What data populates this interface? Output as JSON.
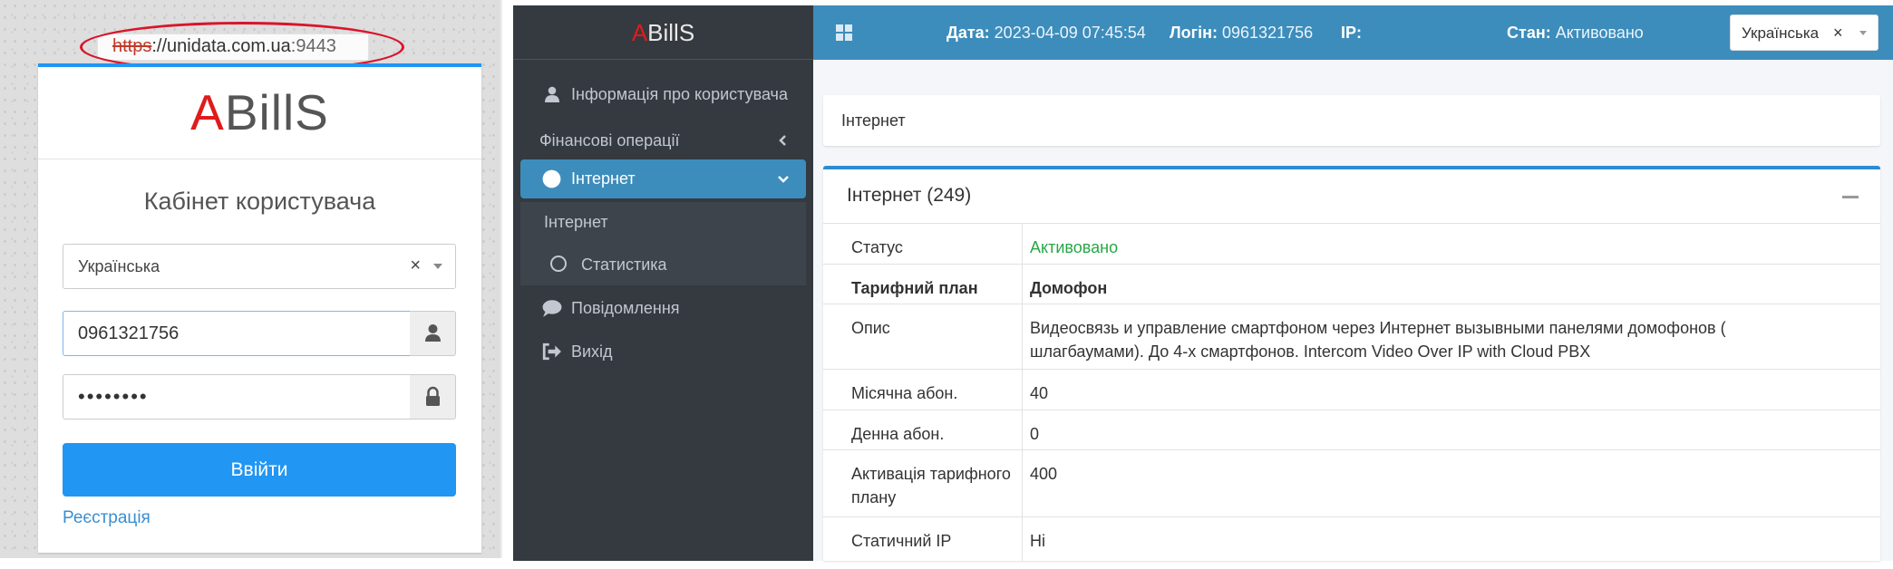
{
  "login": {
    "url_protocol": "https",
    "url_rest": "://unidata.com.ua",
    "url_port": ":9443",
    "logo_a": "A",
    "logo_rest": "BillS",
    "title": "Кабінет користувача",
    "language": "Українська",
    "clear_symbol": "×",
    "phone_value": "0961321756",
    "password_value": "••••••••",
    "login_button": "Ввійти",
    "register_link": "Реєстрація"
  },
  "sidebar": {
    "logo_a": "A",
    "logo_rest": "BillS",
    "items": [
      {
        "label": "Інформація про користувача",
        "icon": "user-icon"
      },
      {
        "label": "Фінансові операції",
        "icon": "chevron-left-icon"
      },
      {
        "label": "Інтернет",
        "icon": "circle-icon",
        "active": true
      },
      {
        "label": "Повідомлення",
        "icon": "comment-icon"
      },
      {
        "label": "Вихід",
        "icon": "sign-out-icon"
      }
    ],
    "sub_items": [
      {
        "label": "Інтернет"
      },
      {
        "label": "Статистика",
        "icon": "circle-outline-icon"
      }
    ]
  },
  "topbar": {
    "date_label": "Дата:",
    "date_value": "2023-04-09 07:45:54",
    "login_label": "Логін:",
    "login_value": "0961321756",
    "ip_label": "IP:",
    "ip_value": "",
    "state_label": "Стан:",
    "state_value": "Активовано",
    "language": "Українська",
    "clear_symbol": "×"
  },
  "breadcrumb": "Інтернет",
  "card": {
    "title": "Інтернет (249)",
    "rows": [
      {
        "key": "Статус",
        "value": "Активовано"
      },
      {
        "key": "Тарифний план",
        "value": "Домофон"
      },
      {
        "key": "Опис",
        "value": "Видеосвязь и управление смартфоном через Интернет вызывными панелями домофонов ( шлагбаумами). До 4-х смартфонов. Intercom Video Over IP with Cloud PBX"
      },
      {
        "key": "Місячна абон.",
        "value": "40"
      },
      {
        "key": "Денна абон.",
        "value": "0"
      },
      {
        "key": "Активація тарифного плану",
        "value": "400"
      },
      {
        "key": "Статичний IP",
        "value": "Ні"
      }
    ]
  },
  "colors": {
    "accent": "#2196f3",
    "topbar": "#3c8dbc",
    "sidebar": "#343a40",
    "status_green": "#28a745",
    "logo_red": "#e01b1b"
  }
}
